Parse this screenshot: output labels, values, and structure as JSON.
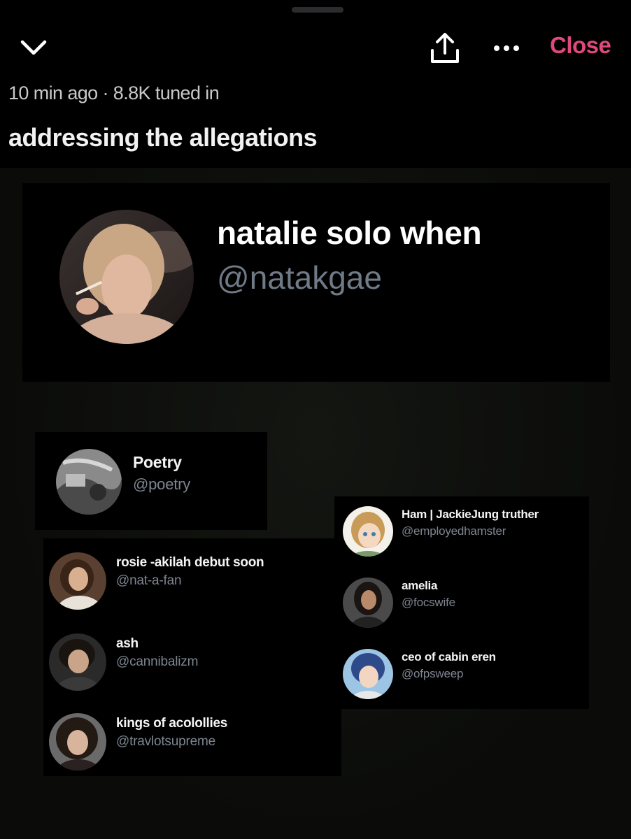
{
  "header": {
    "collapse_icon": "chevron-down-icon",
    "share_icon": "share-icon",
    "more_icon": "ellipsis-icon",
    "close_label": "Close",
    "meta": "10 min ago · 8.8K tuned in",
    "title": "addressing the allegations",
    "accent": "#e0497a"
  },
  "host": {
    "name": "natalie solo when",
    "handle": "@natakgae"
  },
  "speakers": [
    {
      "name": "Poetry",
      "handle": "@poetry"
    },
    {
      "name": "Ham | JackieJung truther",
      "handle": "@employedhamster"
    },
    {
      "name": "rosie -akilah debut soon",
      "handle": "@nat-a-fan"
    },
    {
      "name": "amelia",
      "handle": "@focswife"
    },
    {
      "name": "ash",
      "handle": "@cannibalizm"
    },
    {
      "name": "ceo of cabin eren",
      "handle": "@ofpsweep"
    },
    {
      "name": "kings of acolollies",
      "handle": "@travlotsupreme"
    }
  ]
}
